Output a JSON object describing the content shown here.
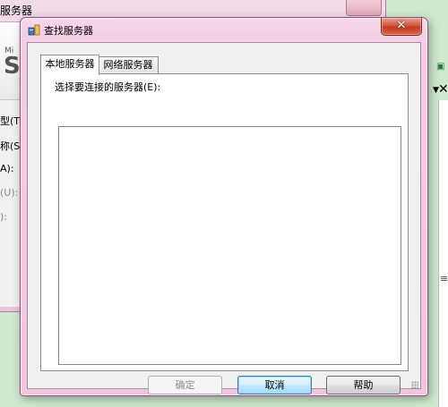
{
  "background": {
    "window_title_fragment": "服务器",
    "banner_small": "Mi",
    "banner_big": "S",
    "labels": [
      {
        "text": "型(T)",
        "dim": false
      },
      {
        "text": "称(S)",
        "dim": false
      },
      {
        "text": "A):",
        "dim": false
      },
      {
        "text": "(U):",
        "dim": true
      },
      {
        "text": "):",
        "dim": true
      }
    ]
  },
  "dialog": {
    "title": "查找服务器",
    "close_glyph": "✕",
    "tabs": [
      {
        "label": "本地服务器",
        "active": true
      },
      {
        "label": "网络服务器",
        "active": false
      }
    ],
    "panel_label": "选择要连接的服务器(E):",
    "buttons": {
      "ok": {
        "label": "确定",
        "enabled": false
      },
      "cancel": {
        "label": "取消",
        "enabled": true
      },
      "help": {
        "label": "帮助",
        "enabled": true
      }
    }
  },
  "colors": {
    "dialog_frame": "#efc5de",
    "close_button": "#c03b20",
    "default_button_border": "#3c7fb1"
  }
}
